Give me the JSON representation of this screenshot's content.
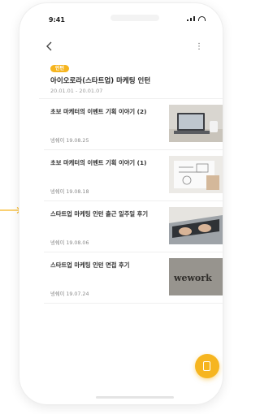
{
  "status": {
    "time": "9:41"
  },
  "event": {
    "tag": "인턴",
    "title": "아이오로라(스타트업) 마케팅 인턴",
    "dates": "20.01.01 - 20.01.07"
  },
  "articles": [
    {
      "title": "초보 마케터의 이벤트 기획 이야기 (2)",
      "author": "넹쉐이",
      "date": "19.08.25",
      "thumb": "laptop-desk"
    },
    {
      "title": "초보 마케터의 이벤트 기획 이야기 (1)",
      "author": "넹쉐이",
      "date": "19.08.18",
      "thumb": "whiteboard-sketch"
    },
    {
      "title": "스타트업 마케팅 인턴 출근 일주일 후기",
      "author": "넹쉐이",
      "date": "19.08.06",
      "thumb": "hands-keyboard"
    },
    {
      "title": "스타트업 마케팅 인턴 면접 후기",
      "author": "넹쉐이",
      "date": "19.07.24",
      "thumb": "wework-sign",
      "thumb_text": "wework"
    }
  ],
  "colors": {
    "accent": "#f6b51f",
    "divider": "#efefef"
  },
  "icons": {
    "back": "chevron-left-icon",
    "menu": "more-vertical-icon",
    "fab": "bookmark-icon",
    "pointer": "arrow-right-icon"
  }
}
